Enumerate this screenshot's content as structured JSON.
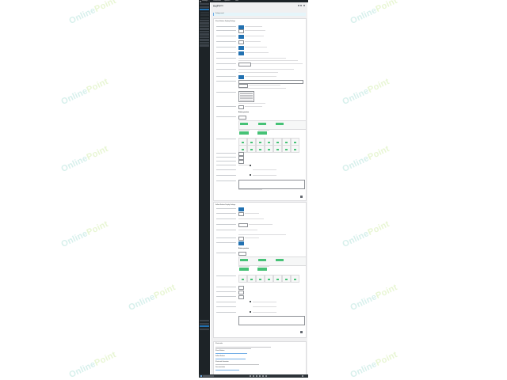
{
  "watermark": {
    "text_main": "Online",
    "text_point": "Point"
  },
  "admin_bar": {
    "site_label": "Settings",
    "items": [
      "Dashboard",
      "Updates",
      "New"
    ]
  },
  "page": {
    "title": "Configure",
    "subtitle": "Settings",
    "notice": "Settings saved."
  },
  "panel1": {
    "title": "Share Buttons Display Settings",
    "preview_heading": "Button preview"
  },
  "panel2": {
    "title": "Follow Buttons Display Settings",
    "preview_heading": "Button preview"
  },
  "bottom_panel": {
    "title": "Shortcodes",
    "headings": [
      "Share Buttons",
      "Follow Buttons",
      "Shortcode Generator",
      "Documentation"
    ]
  },
  "colors": {
    "accent": "#2271b1",
    "green": "#46c276",
    "admin_dark": "#1d2327"
  }
}
